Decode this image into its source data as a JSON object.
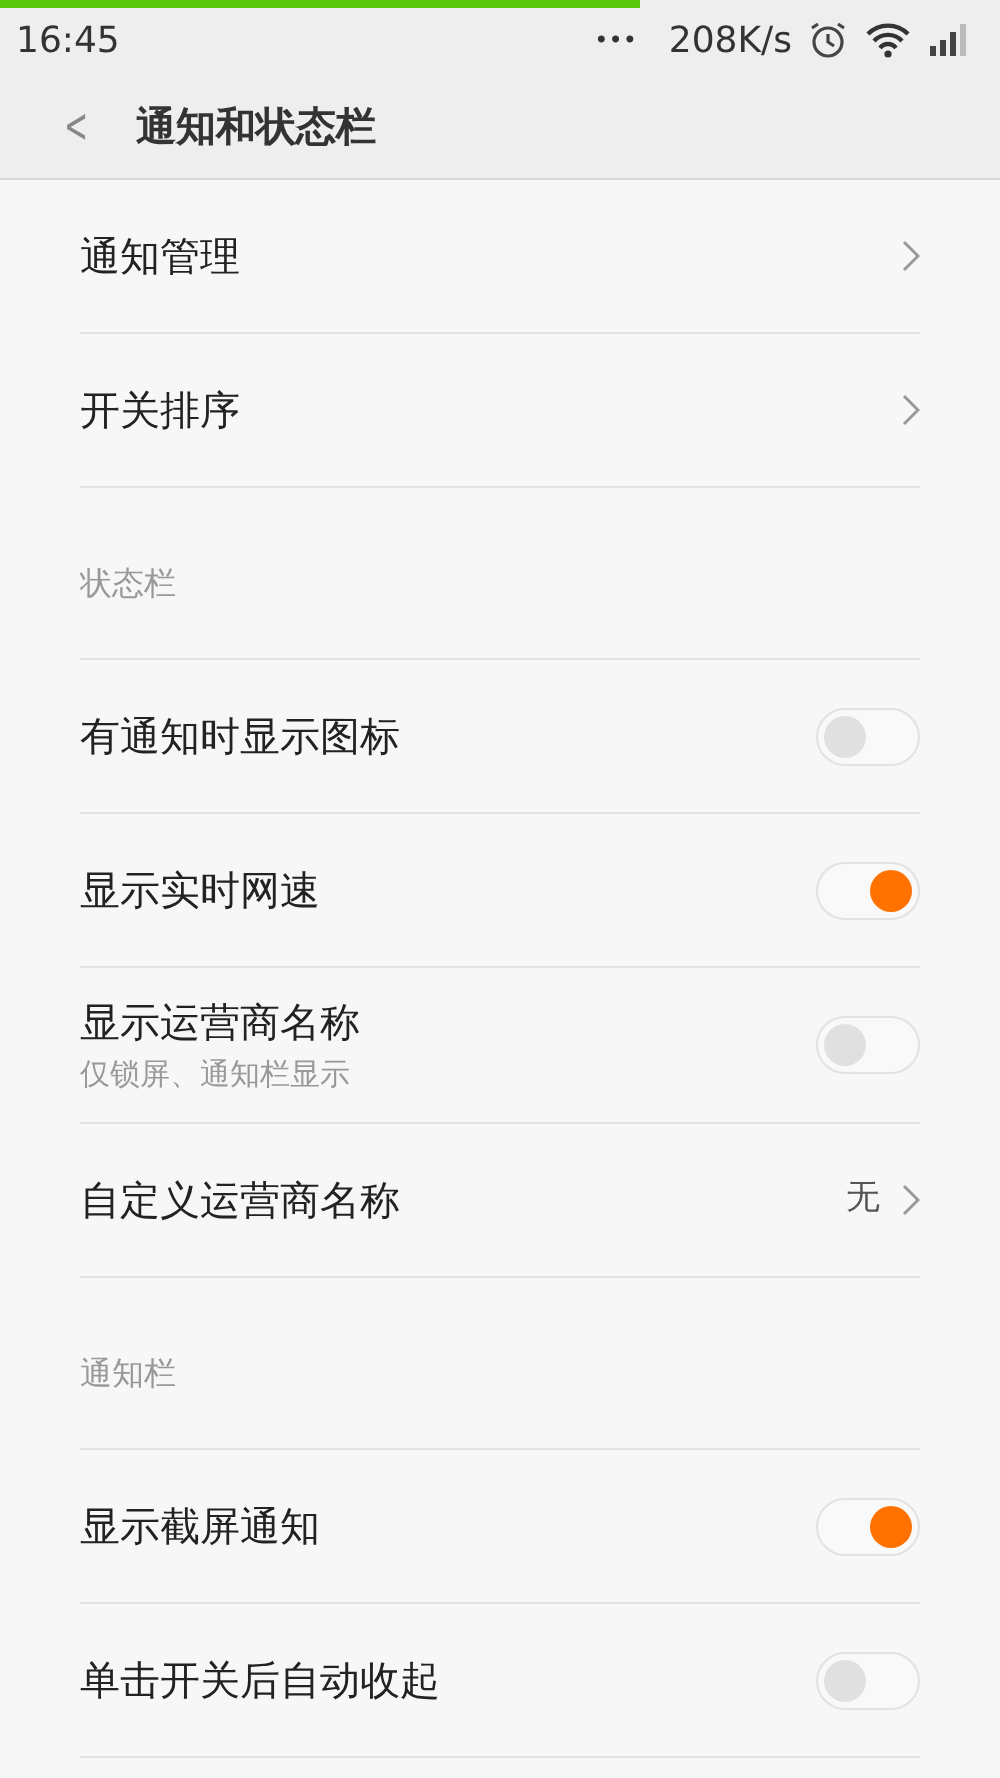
{
  "loading_bar": {
    "level": 0.64
  },
  "status_bar": {
    "time": "16:45",
    "dots": "•••",
    "speed": "208K/s"
  },
  "header": {
    "back": "<",
    "title": "通知和状态栏"
  },
  "sections": [
    {
      "items": [
        {
          "kind": "link",
          "label": "通知管理"
        },
        {
          "kind": "link",
          "label": "开关排序"
        }
      ]
    },
    {
      "title": "状态栏",
      "items": [
        {
          "kind": "toggle",
          "label": "有通知时显示图标",
          "on": false
        },
        {
          "kind": "toggle",
          "label": "显示实时网速",
          "on": true
        },
        {
          "kind": "toggle",
          "label": "显示运营商名称",
          "subtitle": "仅锁屏、通知栏显示",
          "on": false
        },
        {
          "kind": "link",
          "label": "自定义运营商名称",
          "value": "无"
        }
      ]
    },
    {
      "title": "通知栏",
      "items": [
        {
          "kind": "toggle",
          "label": "显示截屏通知",
          "on": true
        },
        {
          "kind": "toggle",
          "label": "单击开关后自动收起",
          "on": false
        }
      ]
    }
  ]
}
